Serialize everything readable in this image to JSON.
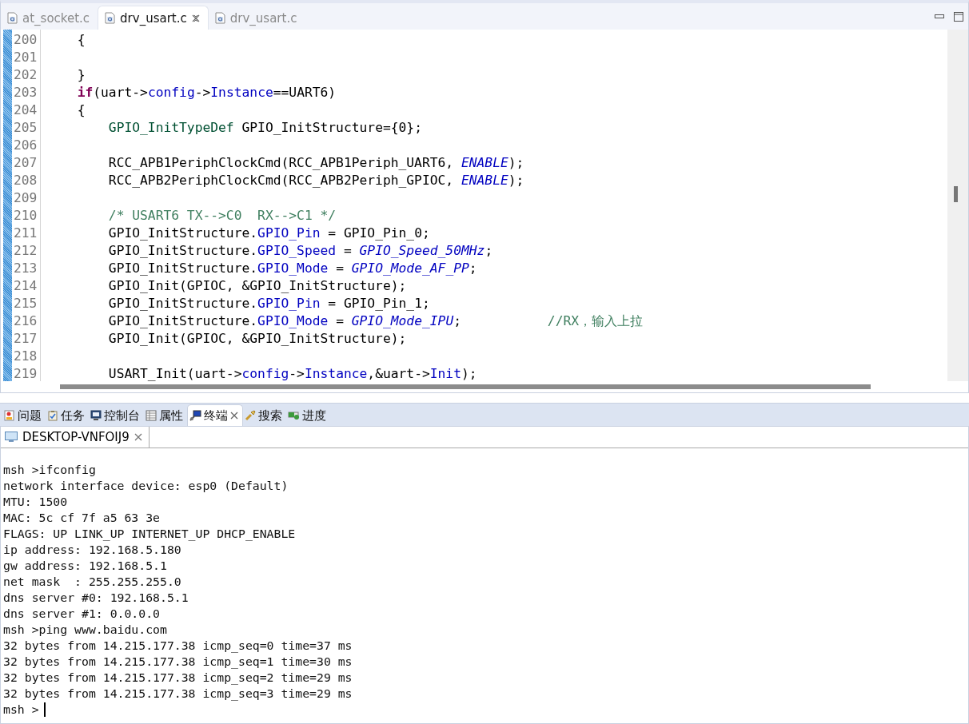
{
  "editor_tabs": [
    {
      "label": "at_socket.c",
      "selected": false,
      "closable": false
    },
    {
      "label": "drv_usart.c",
      "selected": true,
      "closable": true
    },
    {
      "label": "drv_usart.c",
      "selected": false,
      "closable": false
    }
  ],
  "code_lines": [
    {
      "number": "200",
      "tokens": [
        {
          "kind": "plain",
          "text": "    {"
        }
      ]
    },
    {
      "number": "201"
    },
    {
      "number": "202",
      "tokens": [
        {
          "kind": "plain",
          "text": "    }"
        }
      ]
    },
    {
      "number": "203",
      "tokens": [
        {
          "kind": "keyword",
          "text": "    if"
        },
        {
          "kind": "plain",
          "text": "(uart->"
        },
        {
          "kind": "field",
          "text": "config"
        },
        {
          "kind": "plain",
          "text": "->"
        },
        {
          "kind": "field",
          "text": "Instance"
        },
        {
          "kind": "plain",
          "text": "==UART6)"
        }
      ]
    },
    {
      "number": "204",
      "tokens": [
        {
          "kind": "plain",
          "text": "    {"
        }
      ]
    },
    {
      "number": "205",
      "tokens": [
        {
          "kind": "type",
          "text": "        GPIO_InitTypeDef"
        },
        {
          "kind": "plain",
          "text": " GPIO_InitStructure={0};"
        }
      ]
    },
    {
      "number": "206"
    },
    {
      "number": "207",
      "tokens": [
        {
          "kind": "plain",
          "text": "        RCC_APB1PeriphClockCmd(RCC_APB1Periph_UART6, "
        },
        {
          "kind": "macro",
          "text": "ENABLE"
        },
        {
          "kind": "plain",
          "text": ");"
        }
      ]
    },
    {
      "number": "208",
      "tokens": [
        {
          "kind": "plain",
          "text": "        RCC_APB2PeriphClockCmd(RCC_APB2Periph_GPIOC, "
        },
        {
          "kind": "macro",
          "text": "ENABLE"
        },
        {
          "kind": "plain",
          "text": ");"
        }
      ]
    },
    {
      "number": "209"
    },
    {
      "number": "210",
      "tokens": [
        {
          "kind": "comment",
          "text": "        /* USART6 TX-->C0  RX-->C1 */"
        }
      ]
    },
    {
      "number": "211",
      "tokens": [
        {
          "kind": "plain",
          "text": "        GPIO_InitStructure."
        },
        {
          "kind": "field",
          "text": "GPIO_Pin"
        },
        {
          "kind": "plain",
          "text": " = GPIO_Pin_0;"
        }
      ]
    },
    {
      "number": "212",
      "tokens": [
        {
          "kind": "plain",
          "text": "        GPIO_InitStructure."
        },
        {
          "kind": "field",
          "text": "GPIO_Speed"
        },
        {
          "kind": "plain",
          "text": " = "
        },
        {
          "kind": "macro",
          "text": "GPIO_Speed_50MHz"
        },
        {
          "kind": "plain",
          "text": ";"
        }
      ]
    },
    {
      "number": "213",
      "tokens": [
        {
          "kind": "plain",
          "text": "        GPIO_InitStructure."
        },
        {
          "kind": "field",
          "text": "GPIO_Mode"
        },
        {
          "kind": "plain",
          "text": " = "
        },
        {
          "kind": "macro",
          "text": "GPIO_Mode_AF_PP"
        },
        {
          "kind": "plain",
          "text": ";"
        }
      ]
    },
    {
      "number": "214",
      "tokens": [
        {
          "kind": "plain",
          "text": "        GPIO_Init(GPIOC, &GPIO_InitStructure);"
        }
      ]
    },
    {
      "number": "215",
      "tokens": [
        {
          "kind": "plain",
          "text": "        GPIO_InitStructure."
        },
        {
          "kind": "field",
          "text": "GPIO_Pin"
        },
        {
          "kind": "plain",
          "text": " = GPIO_Pin_1;"
        }
      ]
    },
    {
      "number": "216",
      "tokens": [
        {
          "kind": "plain",
          "text": "        GPIO_InitStructure."
        },
        {
          "kind": "field",
          "text": "GPIO_Mode"
        },
        {
          "kind": "plain",
          "text": " = "
        },
        {
          "kind": "macro",
          "text": "GPIO_Mode_IPU"
        },
        {
          "kind": "plain",
          "text": ";           "
        },
        {
          "kind": "comment",
          "text": "//RX，输入上拉"
        }
      ]
    },
    {
      "number": "217",
      "tokens": [
        {
          "kind": "plain",
          "text": "        GPIO_Init(GPIOC, &GPIO_InitStructure);"
        }
      ]
    },
    {
      "number": "218"
    },
    {
      "number": "219",
      "tokens": [
        {
          "kind": "plain",
          "text": "        USART_Init(uart->"
        },
        {
          "kind": "field",
          "text": "config"
        },
        {
          "kind": "plain",
          "text": "->"
        },
        {
          "kind": "field",
          "text": "Instance"
        },
        {
          "kind": "plain",
          "text": ",&uart->"
        },
        {
          "kind": "field",
          "text": "Init"
        },
        {
          "kind": "plain",
          "text": ");"
        }
      ]
    }
  ],
  "panel_tabs": [
    {
      "kind": "problems",
      "label": "问题",
      "selected": false,
      "closable": false
    },
    {
      "kind": "tasks",
      "label": "任务",
      "selected": false,
      "closable": false
    },
    {
      "kind": "console",
      "label": "控制台",
      "selected": false,
      "closable": false
    },
    {
      "kind": "properties",
      "label": "属性",
      "selected": false,
      "closable": false
    },
    {
      "kind": "terminal",
      "label": "终端",
      "selected": true,
      "closable": true
    },
    {
      "kind": "search",
      "label": "搜索",
      "selected": false,
      "closable": false
    },
    {
      "kind": "progress",
      "label": "进度",
      "selected": false,
      "closable": false
    }
  ],
  "terminal_tabs": [
    {
      "label": "DESKTOP-VNFOIJ9"
    }
  ],
  "terminal_lines": [
    "msh >ifconfig",
    "network interface device: esp0 (Default)",
    "MTU: 1500",
    "MAC: 5c cf 7f a5 63 3e",
    "FLAGS: UP LINK_UP INTERNET_UP DHCP_ENABLE",
    "ip address: 192.168.5.180",
    "gw address: 192.168.5.1",
    "net mask  : 255.255.255.0",
    "dns server #0: 192.168.5.1",
    "dns server #1: 0.0.0.0",
    "msh >ping www.baidu.com",
    "32 bytes from 14.215.177.38 icmp_seq=0 time=37 ms",
    "32 bytes from 14.215.177.38 icmp_seq=1 time=30 ms",
    "32 bytes from 14.215.177.38 icmp_seq=2 time=29 ms",
    "32 bytes from 14.215.177.38 icmp_seq=3 time=29 ms"
  ],
  "prompt": "msh >"
}
